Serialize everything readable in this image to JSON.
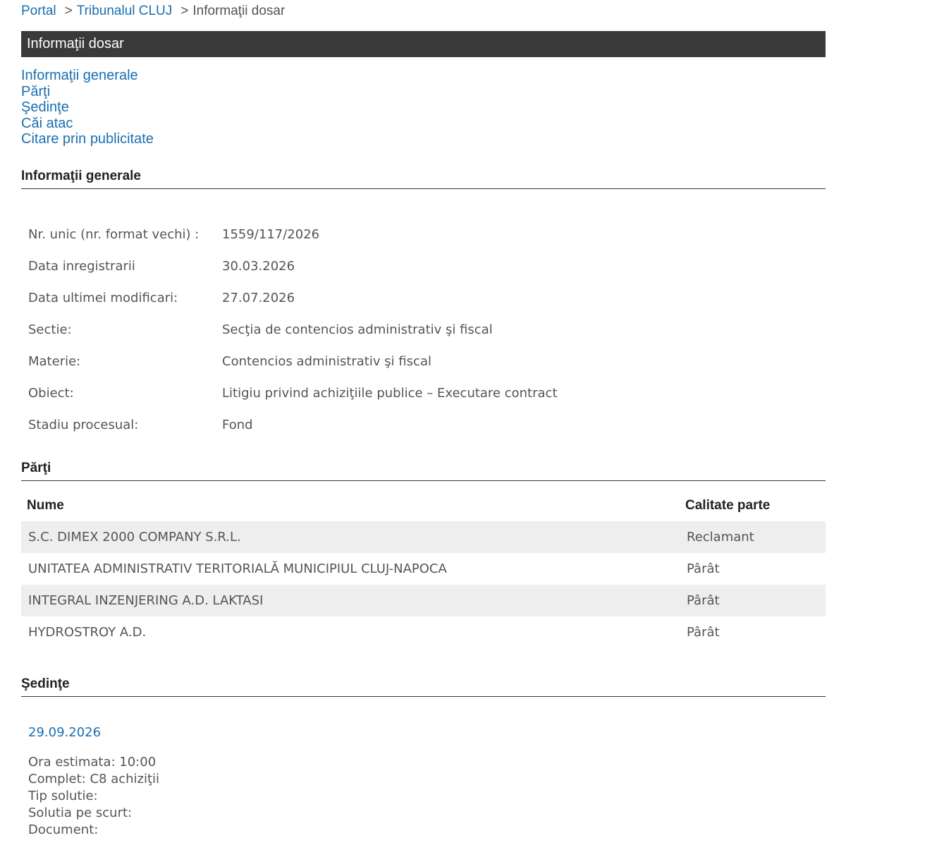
{
  "breadcrumb": {
    "portal": "Portal",
    "sep": ">",
    "court": "Tribunalul CLUJ",
    "current": "Informaţii dosar"
  },
  "title_bar": "Informaţii dosar",
  "anchors": [
    "Informaţii generale",
    "Părţi",
    "Şedinţe",
    "Căi atac",
    "Citare prin publicitate"
  ],
  "general": {
    "heading": "Informaţii generale",
    "rows": [
      {
        "label": "Nr. unic (nr. format vechi) :",
        "value": "1559/117/2026"
      },
      {
        "label": "Data inregistrarii",
        "value": "30.03.2026"
      },
      {
        "label": "Data ultimei modificari:",
        "value": "27.07.2026"
      },
      {
        "label": "Sectie:",
        "value": "Secţia de contencios administrativ şi fiscal"
      },
      {
        "label": "Materie:",
        "value": "Contencios administrativ şi fiscal"
      },
      {
        "label": "Obiect:",
        "value": "Litigiu privind achiziţiile publice – Executare contract"
      },
      {
        "label": "Stadiu procesual:",
        "value": "Fond"
      }
    ]
  },
  "parties": {
    "heading": "Părţi",
    "columns": [
      "Nume",
      "Calitate parte"
    ],
    "rows": [
      {
        "name": "S.C. DIMEX 2000 COMPANY S.R.L.",
        "role": "Reclamant"
      },
      {
        "name": "UNITATEA ADMINISTRATIV TERITORIALĂ MUNICIPIUL CLUJ-NAPOCA",
        "role": "Pârât"
      },
      {
        "name": "INTEGRAL INZENJERING A.D. LAKTASI",
        "role": "Pârât"
      },
      {
        "name": "HYDROSTROY A.D.",
        "role": "Pârât"
      }
    ]
  },
  "hearings": {
    "heading": "Şedinţe",
    "date": "29.09.2026",
    "details": [
      "Ora estimata: 10:00",
      "Complet: C8 achiziţii",
      "Tip solutie:",
      "Solutia pe scurt:",
      "Document:"
    ]
  }
}
